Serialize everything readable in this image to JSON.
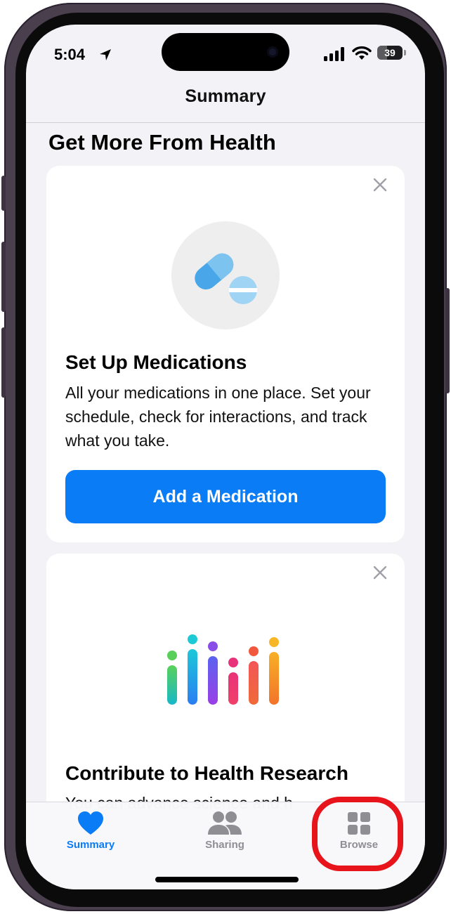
{
  "status_bar": {
    "time": "5:04",
    "battery": "39",
    "battery_fraction": 0.39
  },
  "nav": {
    "title": "Summary"
  },
  "section": {
    "title": "Get More From Health"
  },
  "medications_card": {
    "title": "Set Up Medications",
    "body": "All your medications in one place. Set your schedule, check for interactions, and track what you take.",
    "button_label": "Add a Medication",
    "icon": "pill-capsule-icon"
  },
  "research_card": {
    "title": "Contribute to Health Research",
    "body_partial": "You can advance science and h",
    "icon": "health-research-logo-icon"
  },
  "tabbar": {
    "tabs": [
      {
        "label": "Summary",
        "icon": "heart-icon",
        "active": true
      },
      {
        "label": "Sharing",
        "icon": "people-icon",
        "active": false
      },
      {
        "label": "Browse",
        "icon": "grid-icon",
        "active": false
      }
    ]
  },
  "colors": {
    "accent": "#0a7cf5",
    "annotation": "#e8141b",
    "inactive_tab": "#8e8e93",
    "background": "#f2f2f7"
  }
}
